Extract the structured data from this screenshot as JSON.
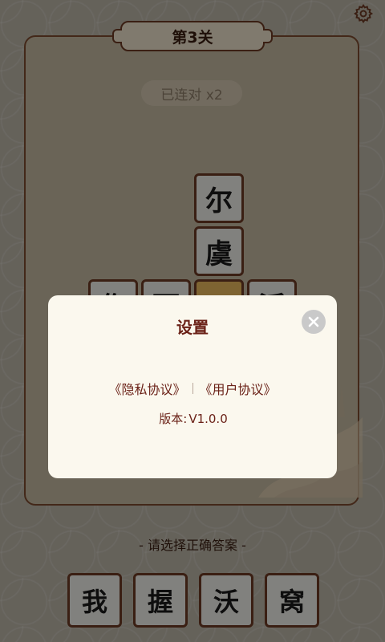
{
  "header": {
    "level_label": "第3关",
    "settings_icon": "gear-icon"
  },
  "streak": {
    "label": "已连对 x2"
  },
  "board": {
    "tiles": [
      "尔",
      "虞",
      "作",
      "而",
      "",
      "活"
    ]
  },
  "prompt": {
    "text": "- 请选择正确答案 -"
  },
  "choices": [
    "我",
    "握",
    "沃",
    "窝"
  ],
  "dialog": {
    "title": "设置",
    "privacy_link": "《隐私协议》",
    "user_link": "《用户协议》",
    "version_label": "版本:",
    "version_value": "V1.0.0",
    "close_icon": "close-icon"
  },
  "colors": {
    "accent_brown": "#6b3a24",
    "title_red": "#6b2218",
    "tile_bg": "#ecebe6",
    "empty_tile": "#e6b75c",
    "dialog_bg": "#fbf8ee"
  }
}
